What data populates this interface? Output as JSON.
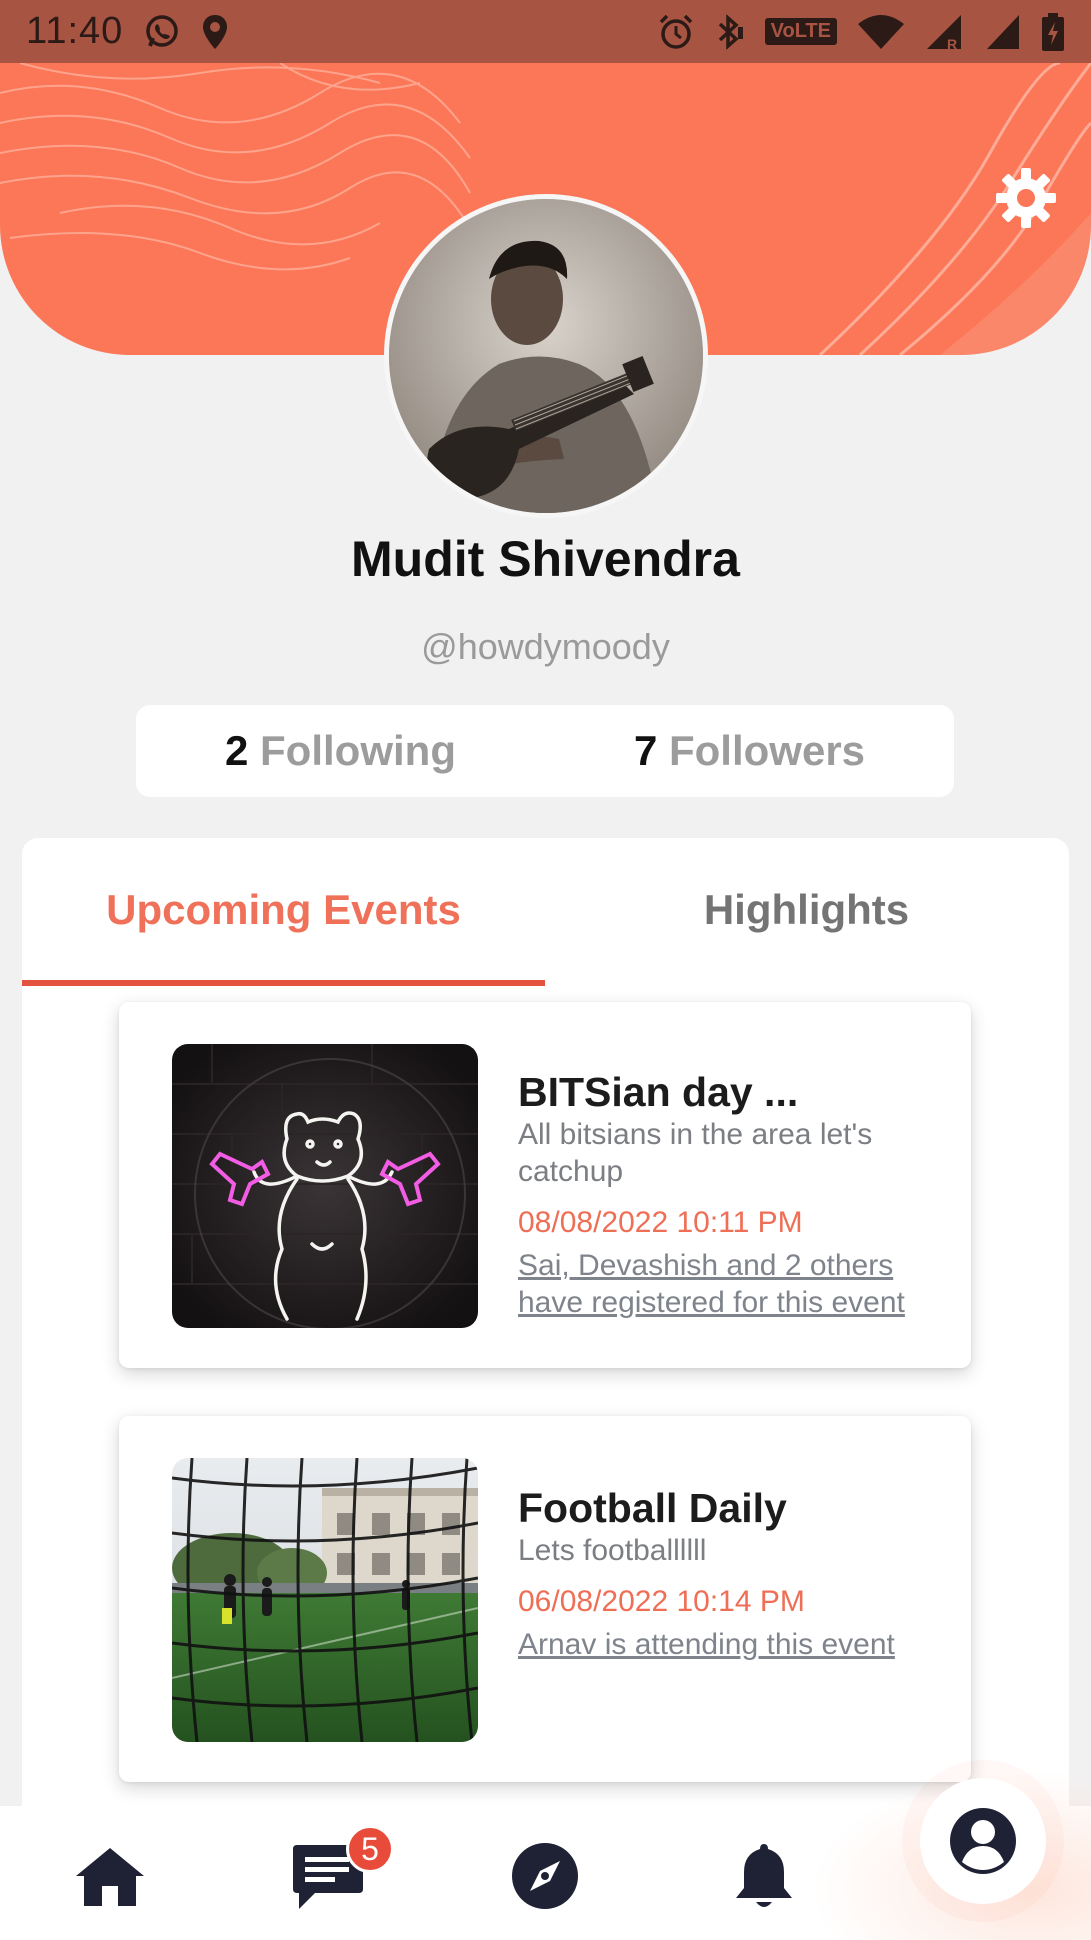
{
  "status_bar": {
    "time": "11:40",
    "left_icons": [
      "whatsapp-icon",
      "location-icon"
    ],
    "right_icons": [
      "alarm-icon",
      "bluetooth-icon",
      "volte-badge",
      "wifi-icon",
      "signal-roaming-icon",
      "signal-icon",
      "battery-charging-icon"
    ],
    "volte_label": "VoLTE"
  },
  "header": {
    "accent_color": "#fb7757",
    "settings_icon": "gear-icon"
  },
  "profile": {
    "name": "Mudit Shivendra",
    "handle": "@howdymoody",
    "following_count": "2",
    "following_label": "Following",
    "followers_count": "7",
    "followers_label": "Followers"
  },
  "tabs": [
    {
      "label": "Upcoming Events",
      "active": true
    },
    {
      "label": "Highlights",
      "active": false
    }
  ],
  "events": [
    {
      "title": "BITSian day ...",
      "description": "All bitsians in the area let's catchup",
      "datetime": "08/08/2022 10:11 PM",
      "attendance": "Sai, Devashish and 2 others have registered for this event",
      "thumbnail": "neon-bear-image"
    },
    {
      "title": "Football Daily",
      "description": "Lets footballllll",
      "datetime": "06/08/2022 10:14 PM",
      "attendance": "Arnav is attending this event",
      "thumbnail": "football-field-image"
    }
  ],
  "bottom_nav": {
    "items": [
      "home-icon",
      "chat-icon",
      "compass-icon",
      "bell-icon",
      "profile-icon"
    ],
    "chat_badge": "5",
    "icon_color": "#1f2235"
  }
}
